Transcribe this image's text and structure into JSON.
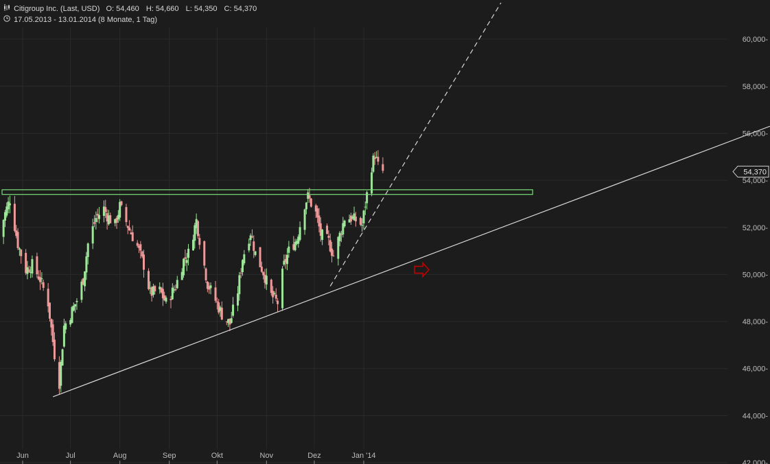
{
  "header": {
    "instrument_icon": "candlestick-icon",
    "title": "Citigroup Inc. (Last, USD)",
    "open": "O: 54,460",
    "high": "H: 54,660",
    "low": "L: 54,350",
    "close": "C: 54,370",
    "range_icon": "clock-icon",
    "range": "17.05.2013 - 13.01.2014 (8 Monate, 1 Tag)"
  },
  "colors": {
    "background": "#1c1c1c",
    "up": "#9ee69a",
    "down": "#ef9a9a",
    "grid": "#2a2a2a",
    "resistance_box": "#7be07b",
    "arrow": "#c00000"
  },
  "chart_data": {
    "type": "candlestick",
    "ylim": [
      42,
      60.5
    ],
    "yticks": [
      42,
      44,
      46,
      48,
      50,
      52,
      54,
      56,
      58,
      60
    ],
    "ytick_labels": [
      "42,000-",
      "44,000-",
      "46,000-",
      "48,000-",
      "50,000-",
      "52,000-",
      "54,000-",
      "56,000-",
      "58,000-",
      "60,000-"
    ],
    "x_labels": [
      "Jun",
      "Jul",
      "Aug",
      "Sep",
      "Okt",
      "Nov",
      "Dez",
      "Jan '14"
    ],
    "x_label_dates": [
      "2013-06-01",
      "2013-07-01",
      "2013-08-01",
      "2013-09-01",
      "2013-10-01",
      "2013-11-01",
      "2013-12-01",
      "2014-01-01"
    ],
    "last_price_label": "54,370",
    "last_price": 54.37,
    "grid": true,
    "close_series": [
      [
        "2013-05-17",
        51.6
      ],
      [
        "2013-05-21",
        52.6
      ],
      [
        "2013-05-24",
        53.2
      ],
      [
        "2013-05-29",
        51.3
      ],
      [
        "2013-06-03",
        50.2
      ],
      [
        "2013-06-07",
        50.4
      ],
      [
        "2013-06-12",
        49.8
      ],
      [
        "2013-06-17",
        48.8
      ],
      [
        "2013-06-21",
        46.6
      ],
      [
        "2013-06-24",
        45.4
      ],
      [
        "2013-06-27",
        47.8
      ],
      [
        "2013-07-01",
        48.3
      ],
      [
        "2013-07-05",
        48.9
      ],
      [
        "2013-07-09",
        49.8
      ],
      [
        "2013-07-12",
        51.3
      ],
      [
        "2013-07-17",
        52.4
      ],
      [
        "2013-07-22",
        52.8
      ],
      [
        "2013-07-24",
        52.5
      ],
      [
        "2013-07-29",
        52.1
      ],
      [
        "2013-08-01",
        52.9
      ],
      [
        "2013-08-07",
        51.9
      ],
      [
        "2013-08-12",
        51.2
      ],
      [
        "2013-08-16",
        50.4
      ],
      [
        "2013-08-20",
        49.2
      ],
      [
        "2013-08-26",
        49.3
      ],
      [
        "2013-08-30",
        48.8
      ],
      [
        "2013-09-05",
        49.5
      ],
      [
        "2013-09-10",
        50.6
      ],
      [
        "2013-09-13",
        50.9
      ],
      [
        "2013-09-18",
        52.3
      ],
      [
        "2013-09-20",
        51.5
      ],
      [
        "2013-09-25",
        49.6
      ],
      [
        "2013-09-30",
        48.9
      ],
      [
        "2013-10-04",
        48.3
      ],
      [
        "2013-10-09",
        47.9
      ],
      [
        "2013-10-14",
        49.3
      ],
      [
        "2013-10-17",
        50.7
      ],
      [
        "2013-10-22",
        51.8
      ],
      [
        "2013-10-25",
        50.9
      ],
      [
        "2013-10-30",
        50.1
      ],
      [
        "2013-11-04",
        49.1
      ],
      [
        "2013-11-08",
        48.8
      ],
      [
        "2013-11-12",
        50.4
      ],
      [
        "2013-11-15",
        51.0
      ],
      [
        "2013-11-20",
        51.5
      ],
      [
        "2013-11-25",
        53.0
      ],
      [
        "2013-11-27",
        53.3
      ],
      [
        "2013-12-02",
        52.6
      ],
      [
        "2013-12-05",
        51.7
      ],
      [
        "2013-12-10",
        51.4
      ],
      [
        "2013-12-13",
        50.8
      ],
      [
        "2013-12-18",
        51.9
      ],
      [
        "2013-12-20",
        52.4
      ],
      [
        "2013-12-24",
        52.4
      ],
      [
        "2013-12-27",
        52.3
      ],
      [
        "2013-12-31",
        52.1
      ],
      [
        "2014-01-02",
        53.0
      ],
      [
        "2014-01-06",
        54.6
      ],
      [
        "2014-01-08",
        55.1
      ],
      [
        "2014-01-10",
        54.6
      ],
      [
        "2014-01-13",
        54.37
      ]
    ],
    "annotations": {
      "resistance_zone": {
        "from_date": "2013-05-17",
        "to_date": "2014-01-20",
        "low": 53.4,
        "high": 53.6
      },
      "support_trendline": {
        "from": [
          "2013-06-20",
          44.8
        ],
        "to": [
          "2014-04-25",
          56.3
        ]
      },
      "dashed_trendline": {
        "from": [
          "2013-12-11",
          49.5
        ],
        "to": [
          "2014-03-15",
          61.5
        ]
      },
      "arrow": {
        "date": "2014-02-12",
        "value": 50.2,
        "direction": "right"
      }
    }
  }
}
